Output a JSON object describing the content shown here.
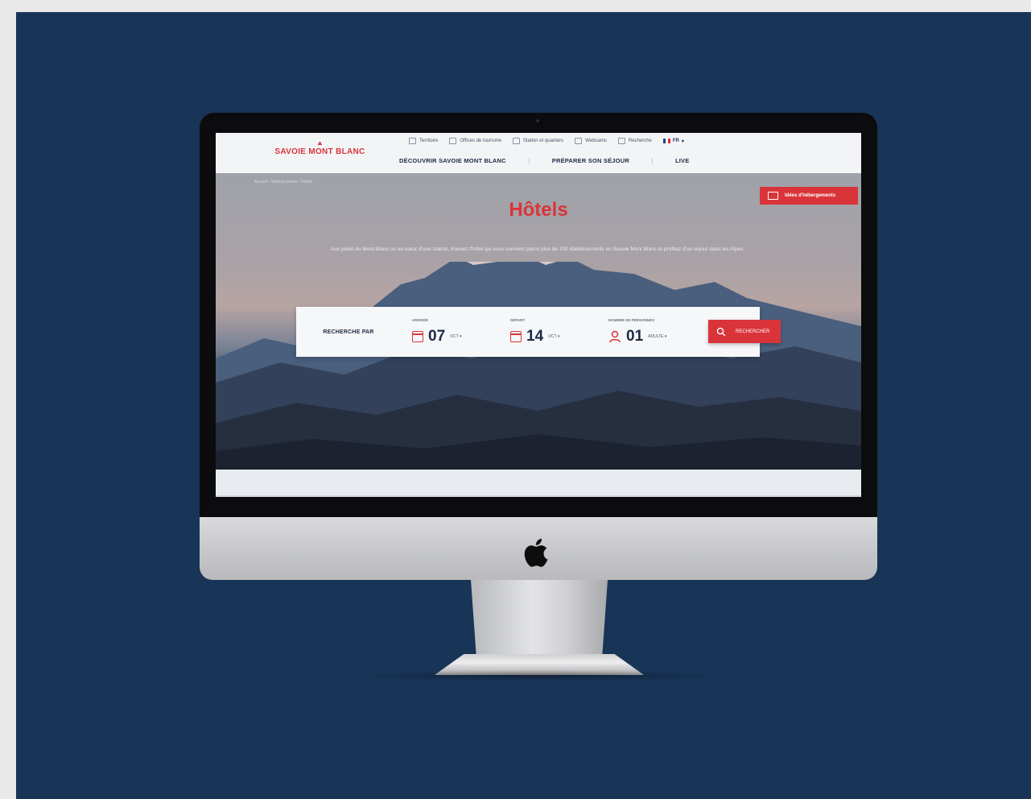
{
  "site": {
    "logo_mark": "⛰",
    "logo_text": "SAVOIE MONT BLANC",
    "utility_nav": [
      {
        "label": "Territoire",
        "icon": "map-icon"
      },
      {
        "label": "Offices de tourisme",
        "icon": "info-icon"
      },
      {
        "label": "Station et quartiers",
        "icon": "station-icon"
      },
      {
        "label": "Webcams",
        "icon": "webcam-icon"
      },
      {
        "label": "Recherche",
        "icon": "search-icon"
      }
    ],
    "language": "FR",
    "main_nav": [
      "DÉCOUVRIR SAVOIE MONT BLANC",
      "PRÉPARER SON SÉJOUR",
      "LIVE"
    ],
    "breadcrumb": "Accueil  ›  Hébergements  ›  Hôtels",
    "ideas_button": "Idées d'hébergements",
    "title": "Hôtels",
    "description": "Aux pieds du Mont-Blanc ou au cœur d'une station, trouvez l'hôtel qui vous convient parmi plus de 700 établissements en Savoie Mont Blanc et profitez d'un séjour dans les Alpes.",
    "search": {
      "label": "RECHERCHE PAR",
      "arrival": {
        "label": "ARRIVÉE",
        "day": "07",
        "month": "OCT ▾"
      },
      "departure": {
        "label": "DÉPART",
        "day": "14",
        "month": "OCT ▾"
      },
      "people": {
        "label": "NOMBRE DE PERSONNES",
        "count": "01",
        "unit": "ADULTE ▾"
      },
      "button": "RECHERCHER"
    },
    "colors": {
      "brand_red": "#d9343a",
      "navy": "#183456"
    }
  }
}
